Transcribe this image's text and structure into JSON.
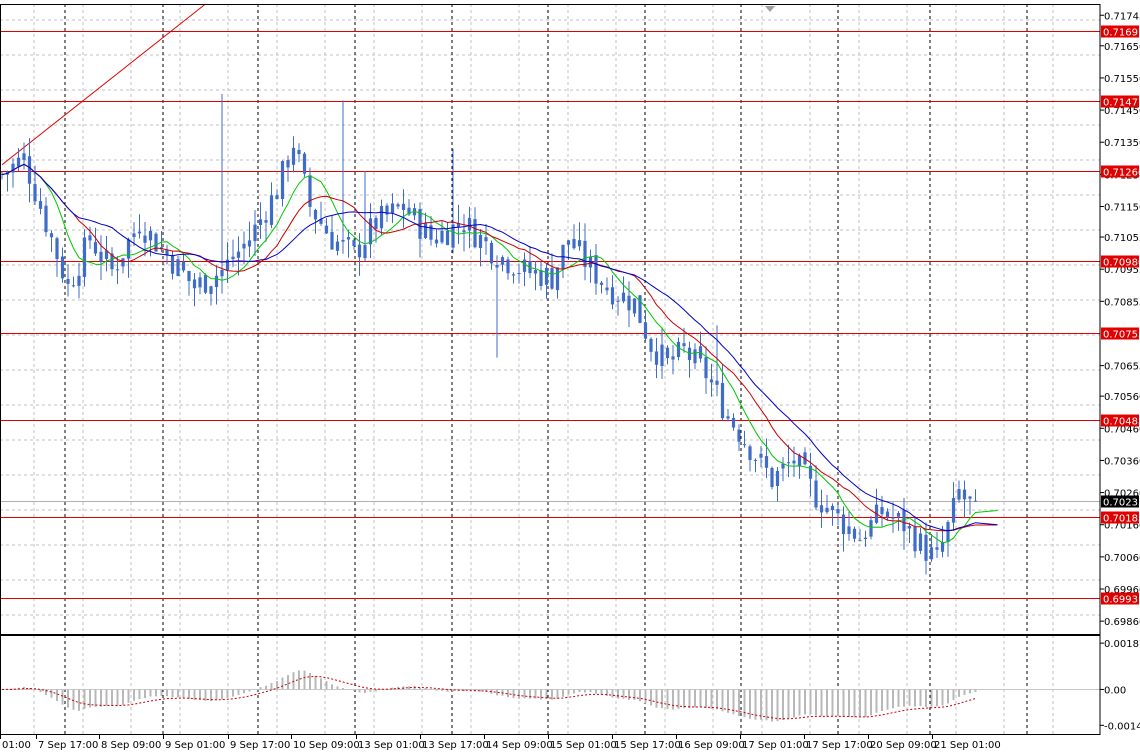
{
  "chart_data": {
    "type": "candlestick",
    "price_axis": {
      "ylim": [
        0.6982,
        0.7178
      ],
      "ticks": [
        "0.71745",
        "0.71650",
        "0.71550",
        "0.71450",
        "0.71350",
        "0.71250",
        "0.71150",
        "0.71055",
        "0.70955",
        "0.70855",
        "0.70655",
        "0.70560",
        "0.70460",
        "0.70360",
        "0.70260",
        "0.70160",
        "0.70060",
        "0.69960",
        "0.69860"
      ]
    },
    "time_axis": {
      "labels": [
        "01:00",
        "7 Sep 17:00",
        "8 Sep 09:00",
        "9 Sep 01:00",
        "9 Sep 17:00",
        "10 Sep 09:00",
        "13 Sep 01:00",
        "13 Sep 17:00",
        "14 Sep 09:00",
        "15 Sep 01:00",
        "15 Sep 17:00",
        "16 Sep 09:00",
        "17 Sep 01:00",
        "17 Sep 17:00",
        "20 Sep 09:00",
        "21 Sep 01:00"
      ]
    },
    "levels": [
      "0.71697",
      "0.71477",
      "0.71260",
      "0.70980",
      "0.70755",
      "0.70485",
      "0.70183",
      "0.69931"
    ],
    "current_price": "0.70233",
    "price_path": [
      [
        0,
        0.7125
      ],
      [
        4,
        0.713
      ],
      [
        8,
        0.711
      ],
      [
        12,
        0.709
      ],
      [
        16,
        0.7105
      ],
      [
        20,
        0.7095
      ],
      [
        25,
        0.711
      ],
      [
        30,
        0.71
      ],
      [
        35,
        0.709
      ],
      [
        40,
        0.7095
      ],
      [
        45,
        0.7105
      ],
      [
        50,
        0.712
      ],
      [
        53,
        0.7135
      ],
      [
        56,
        0.7115
      ],
      [
        60,
        0.7105
      ],
      [
        64,
        0.71
      ],
      [
        68,
        0.711
      ],
      [
        73,
        0.7115
      ],
      [
        78,
        0.7105
      ],
      [
        84,
        0.711
      ],
      [
        90,
        0.71
      ],
      [
        95,
        0.7095
      ],
      [
        100,
        0.7093
      ],
      [
        103,
        0.7105
      ],
      [
        106,
        0.7098
      ],
      [
        110,
        0.709
      ],
      [
        115,
        0.7085
      ],
      [
        118,
        0.7072
      ],
      [
        121,
        0.7066
      ],
      [
        124,
        0.707
      ],
      [
        128,
        0.7063
      ],
      [
        132,
        0.705
      ],
      [
        136,
        0.704
      ],
      [
        140,
        0.703
      ],
      [
        144,
        0.7036
      ],
      [
        148,
        0.7025
      ],
      [
        152,
        0.7018
      ],
      [
        156,
        0.7012
      ],
      [
        160,
        0.702
      ],
      [
        164,
        0.7016
      ],
      [
        168,
        0.7008
      ],
      [
        170,
        0.7005
      ],
      [
        172,
        0.7015
      ],
      [
        174,
        0.7026
      ],
      [
        176,
        0.7022
      ]
    ],
    "spikes": [
      [
        40,
        0.715
      ],
      [
        62,
        0.7148
      ],
      [
        66,
        0.7126
      ],
      [
        82,
        0.7133
      ],
      [
        90,
        0.7068
      ],
      [
        130,
        0.7078
      ]
    ],
    "ma_periods": [
      8,
      14,
      21
    ],
    "ma_colors": [
      "#00c800",
      "#c80000",
      "#0000c8"
    ],
    "trendline": [
      [
        0,
        0.7128
      ],
      [
        37,
        0.7178
      ]
    ],
    "oscillator": {
      "ylim": [
        -0.0018,
        0.0022
      ],
      "ticks": [
        "0.001871",
        "0.00",
        "-0.00145"
      ]
    },
    "colors": {
      "candle": "#3f6cc8",
      "level": "#e00000",
      "grid": "#c0c0c0",
      "current": "#000000"
    }
  }
}
